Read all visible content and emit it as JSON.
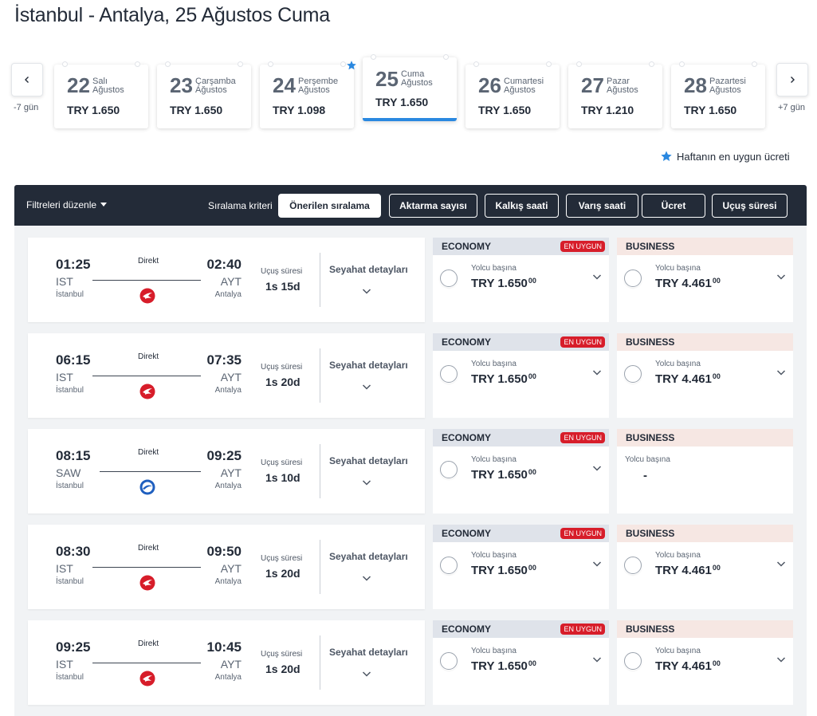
{
  "page": {
    "title": "İstanbul - Antalya, 25 Ağustos Cuma"
  },
  "date_nav": {
    "prev_label": "-7 gün",
    "next_label": "+7 gün",
    "prev_icon": "chevron-left-icon",
    "next_icon": "chevron-right-icon",
    "days": [
      {
        "num": "22",
        "name": "Salı",
        "month": "Ağustos",
        "price": "TRY 1.650",
        "selected": false,
        "cheapest": false
      },
      {
        "num": "23",
        "name": "Çarşamba",
        "month": "Ağustos",
        "price": "TRY 1.650",
        "selected": false,
        "cheapest": false
      },
      {
        "num": "24",
        "name": "Perşembe",
        "month": "Ağustos",
        "price": "TRY 1.098",
        "selected": false,
        "cheapest": true
      },
      {
        "num": "25",
        "name": "Cuma",
        "month": "Ağustos",
        "price": "TRY 1.650",
        "selected": true,
        "cheapest": false
      },
      {
        "num": "26",
        "name": "Cumartesi",
        "month": "Ağustos",
        "price": "TRY 1.650",
        "selected": false,
        "cheapest": false
      },
      {
        "num": "27",
        "name": "Pazar",
        "month": "Ağustos",
        "price": "TRY 1.210",
        "selected": false,
        "cheapest": false
      },
      {
        "num": "28",
        "name": "Pazartesi",
        "month": "Ağustos",
        "price": "TRY 1.650",
        "selected": false,
        "cheapest": false
      }
    ],
    "cheapest_note": "Haftanın en uygun ücreti"
  },
  "sort_bar": {
    "filters_label": "Filtreleri düzenle",
    "criteria_label": "Sıralama kriteri",
    "buttons": [
      {
        "label": "Önerilen sıralama",
        "active": true
      },
      {
        "label": "Aktarma sayısı",
        "active": false
      },
      {
        "label": "Kalkış saati",
        "active": false
      },
      {
        "label": "Varış saati",
        "active": false
      },
      {
        "label": "Ücret",
        "active": false
      },
      {
        "label": "Uçuş süresi",
        "active": false
      }
    ]
  },
  "labels": {
    "direct": "Direkt",
    "duration": "Uçuş süresi",
    "details": "Seyahat detayları",
    "per_pax": "Yolcu başına",
    "economy": "ECONOMY",
    "business": "BUSINESS",
    "best_badge": "EN UYGUN"
  },
  "colors": {
    "accent": "#2a88e0",
    "dark_bar": "#232b38",
    "badge_red": "#d71d2a",
    "thy_red": "#d71d2a",
    "ajet_blue": "#1f5fbf"
  },
  "flights": [
    {
      "dep_time": "01:25",
      "dep_code": "IST",
      "dep_city": "İstanbul",
      "arr_time": "02:40",
      "arr_code": "AYT",
      "arr_city": "Antalya",
      "duration": "1s 15d",
      "airline_icon": "turkish-airlines-logo-icon",
      "eco_price": "TRY 1.650",
      "eco_cents": "00",
      "bus_price": "TRY 4.461",
      "bus_cents": "00",
      "bus_available": true
    },
    {
      "dep_time": "06:15",
      "dep_code": "IST",
      "dep_city": "İstanbul",
      "arr_time": "07:35",
      "arr_code": "AYT",
      "arr_city": "Antalya",
      "duration": "1s 20d",
      "airline_icon": "turkish-airlines-logo-icon",
      "eco_price": "TRY 1.650",
      "eco_cents": "00",
      "bus_price": "TRY 4.461",
      "bus_cents": "00",
      "bus_available": true
    },
    {
      "dep_time": "08:15",
      "dep_code": "SAW",
      "dep_city": "İstanbul",
      "arr_time": "09:25",
      "arr_code": "AYT",
      "arr_city": "Antalya",
      "duration": "1s 10d",
      "airline_icon": "ajet-logo-icon",
      "eco_price": "TRY 1.650",
      "eco_cents": "00",
      "bus_price": "-",
      "bus_cents": "",
      "bus_available": false
    },
    {
      "dep_time": "08:30",
      "dep_code": "IST",
      "dep_city": "İstanbul",
      "arr_time": "09:50",
      "arr_code": "AYT",
      "arr_city": "Antalya",
      "duration": "1s 20d",
      "airline_icon": "turkish-airlines-logo-icon",
      "eco_price": "TRY 1.650",
      "eco_cents": "00",
      "bus_price": "TRY 4.461",
      "bus_cents": "00",
      "bus_available": true
    },
    {
      "dep_time": "09:25",
      "dep_code": "IST",
      "dep_city": "İstanbul",
      "arr_time": "10:45",
      "arr_code": "AYT",
      "arr_city": "Antalya",
      "duration": "1s 20d",
      "airline_icon": "turkish-airlines-logo-icon",
      "eco_price": "TRY 1.650",
      "eco_cents": "00",
      "bus_price": "TRY 4.461",
      "bus_cents": "00",
      "bus_available": true
    }
  ]
}
